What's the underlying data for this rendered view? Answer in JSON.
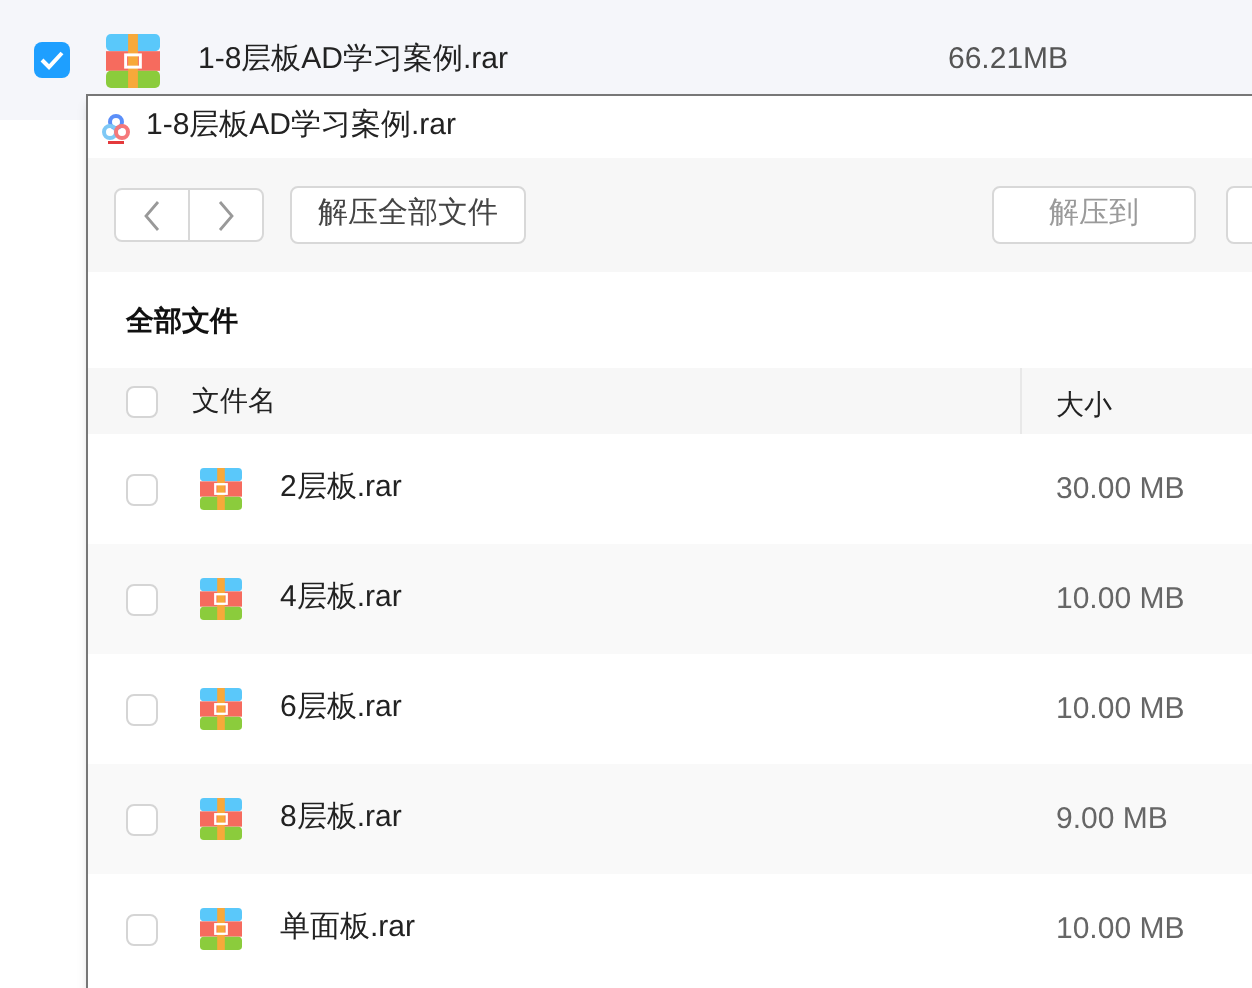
{
  "background_file": {
    "checked": true,
    "name": "1-8层板AD学习案例.rar",
    "size": "66.21MB"
  },
  "window": {
    "title": "1-8层板AD学习案例.rar"
  },
  "toolbar": {
    "buttons": [
      {
        "label": "解压全部文件",
        "disabled": false
      },
      {
        "label": "解压到",
        "disabled": true
      }
    ]
  },
  "section_title": "全部文件",
  "table": {
    "all_checked": false,
    "columns": [
      "文件名",
      "大小"
    ],
    "rows": [
      {
        "name": "2层板.rar",
        "size": "30.00 MB",
        "checked": false
      },
      {
        "name": "4层板.rar",
        "size": "10.00 MB",
        "checked": false
      },
      {
        "name": "6层板.rar",
        "size": "10.00 MB",
        "checked": false
      },
      {
        "name": "8层板.rar",
        "size": "9.00 MB",
        "checked": false
      },
      {
        "name": "单面板.rar",
        "size": "10.00 MB",
        "checked": false
      }
    ]
  }
}
